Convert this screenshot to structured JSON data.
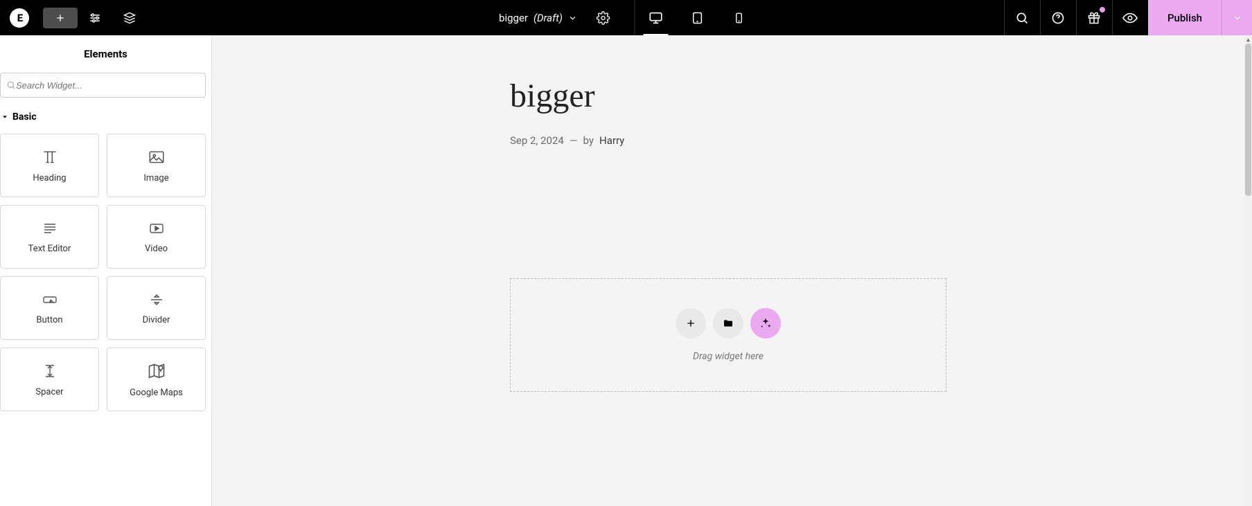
{
  "topbar": {
    "logo_text": "E",
    "page_name": "bigger",
    "page_status": "(Draft)",
    "publish_label": "Publish"
  },
  "sidebar": {
    "title": "Elements",
    "search_placeholder": "Search Widget...",
    "category": "Basic",
    "widgets": [
      {
        "label": "Heading"
      },
      {
        "label": "Image"
      },
      {
        "label": "Text Editor"
      },
      {
        "label": "Video"
      },
      {
        "label": "Button"
      },
      {
        "label": "Divider"
      },
      {
        "label": "Spacer"
      },
      {
        "label": "Google Maps"
      }
    ]
  },
  "post": {
    "title": "bigger",
    "date": "Sep 2, 2024",
    "separator": "—",
    "by_label": "by",
    "author": "Harry"
  },
  "dropzone": {
    "hint": "Drag widget here"
  }
}
